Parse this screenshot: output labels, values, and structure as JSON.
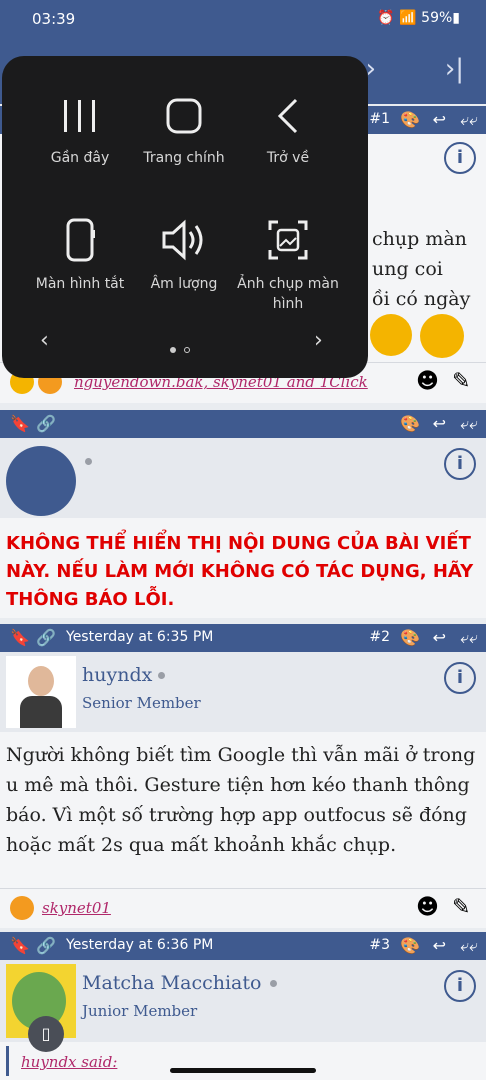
{
  "status_bar": {
    "time": "03:39",
    "battery": "59%"
  },
  "assistant_menu": {
    "items": [
      {
        "label": "Gần đây",
        "icon": "recents-icon"
      },
      {
        "label": "Trang chính",
        "icon": "home-icon"
      },
      {
        "label": "Trở về",
        "icon": "back-icon"
      },
      {
        "label": "Màn hình tắt",
        "icon": "screen-off-icon"
      },
      {
        "label": "Âm lượng",
        "icon": "volume-icon"
      },
      {
        "label": "Ảnh chụp màn hình",
        "icon": "screenshot-icon"
      }
    ],
    "page_index": 1,
    "page_count": 2
  },
  "post1": {
    "number": "#1",
    "partial_text": [
      "chụp màn",
      "ung coi",
      "ồi có ngày"
    ],
    "likes": "nguyendown.bak, skynet01 and 1Click"
  },
  "post_hidden": {
    "error": "KHÔNG THỂ HIỂN THỊ NỘI DUNG CỦA BÀI VIẾT NÀY. NẾU LÀM MỚI KHÔNG CÓ TÁC DỤNG, HÃY THÔNG BÁO LỖI."
  },
  "post2": {
    "time": "Yesterday at 6:35 PM",
    "number": "#2",
    "username": "huyndx",
    "role": "Senior Member",
    "body": "Người không biết tìm Google thì vẫn mãi ở trong u mê mà thôi. Gesture tiện hơn kéo thanh thông báo. Vì một số trường hợp app outfocus sẽ đóng hoặc mất 2s qua mất khoảnh khắc chụp.",
    "likes": "skynet01"
  },
  "post3": {
    "time": "Yesterday at 6:36 PM",
    "number": "#3",
    "username": "Matcha Macchiato",
    "role": "Junior Member",
    "partial_quote": "huyndx said:"
  }
}
